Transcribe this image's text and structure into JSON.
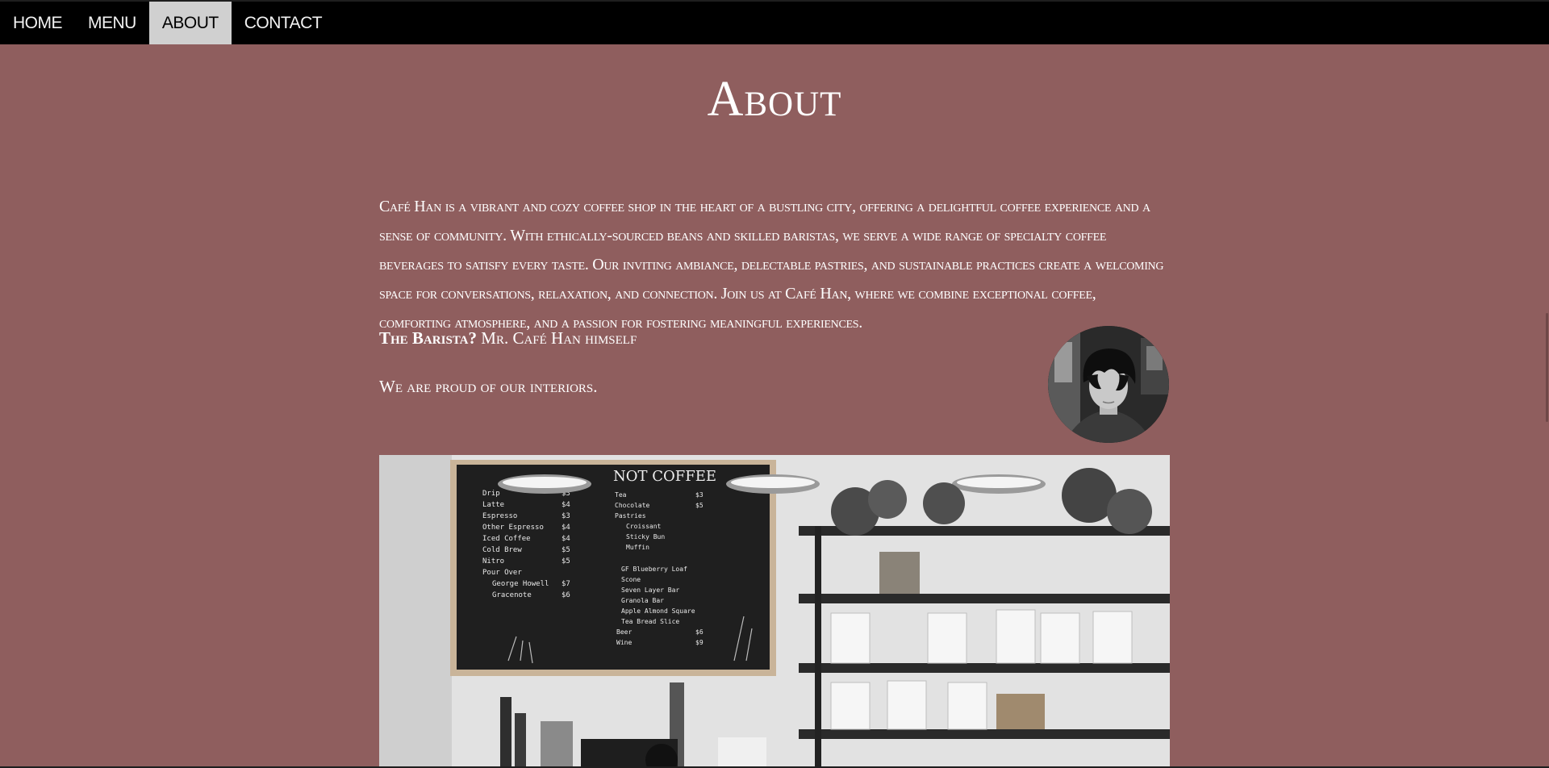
{
  "nav": {
    "items": [
      {
        "label": "HOME"
      },
      {
        "label": "MENU"
      },
      {
        "label": "ABOUT"
      },
      {
        "label": "CONTACT"
      }
    ],
    "active": "ABOUT"
  },
  "page": {
    "title": "About",
    "intro": "Café Han is a vibrant and cozy coffee shop in the heart of a bustling city, offering a delightful coffee experience and a sense of community. With ethically-sourced beans and skilled baristas, we serve a wide range of specialty coffee beverages to satisfy every taste. Our inviting ambiance, delectable pastries, and sustainable practices create a welcoming space for conversations, relaxation, and connection. Join us at Café Han, where we combine exceptional coffee, comforting atmosphere, and a passion for fostering meaningful experiences.",
    "barista_label": "The Barista?",
    "barista_text": " Mr. Café Han himself",
    "interiors_text": "We are proud of our interiors."
  },
  "photo": {
    "chalkboard_heading": "NOT COFFEE",
    "chalkboard_left": [
      "Drip",
      "Latte",
      "Espresso",
      "Other Espresso",
      "Iced Coffee",
      "Cold Brew",
      "Nitro",
      "Pour Over",
      "George Howell",
      "Gracenote"
    ],
    "chalkboard_left_prices": [
      "$3",
      "$4",
      "$3",
      "$4",
      "$4",
      "$5",
      "$5",
      "",
      "$7",
      "$6"
    ],
    "chalkboard_right": [
      "Tea",
      "Chocolate",
      "Pastries",
      "Croissant",
      "Sticky Bun",
      "Muffin",
      "GF Blueberry Loaf",
      "Scone",
      "Seven Layer Bar",
      "Granola Bar",
      "Apple Almond Square",
      "Tea Bread Slice",
      "Beer",
      "Wine"
    ],
    "chalkboard_right_prices": [
      "$3",
      "$5",
      "",
      "",
      "",
      "",
      "",
      "",
      "",
      "",
      "",
      "",
      "$6",
      "$9"
    ]
  }
}
